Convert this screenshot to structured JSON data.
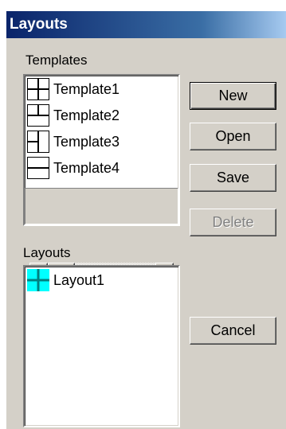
{
  "window": {
    "title": "Layouts"
  },
  "templates": {
    "label": "Templates",
    "items": [
      {
        "label": "Template1",
        "icon": "grid-2x2-icon"
      },
      {
        "label": "Template2",
        "icon": "top-split-layout-icon"
      },
      {
        "label": "Template3",
        "icon": "left-split-layout-icon"
      },
      {
        "label": "Template4",
        "icon": "horizontal-split-layout-icon"
      }
    ]
  },
  "layouts": {
    "label": "Layouts",
    "items": [
      {
        "label": "Layout1",
        "icon": "grid-2x2-cyan-icon"
      }
    ]
  },
  "buttons": {
    "new": "New",
    "open": "Open",
    "save": "Save",
    "delete": "Delete",
    "cancel": "Cancel"
  },
  "colors": {
    "dialog_bg": "#d4d0c8",
    "titlebar_start": "#0a246a",
    "titlebar_end": "#a6caf0",
    "layout_icon": "#00ffff",
    "disabled_text": "#808080"
  },
  "scrollbar": {
    "arrow_left": "scroll-left-arrow-icon",
    "arrow_right": "scroll-right-arrow-icon"
  }
}
